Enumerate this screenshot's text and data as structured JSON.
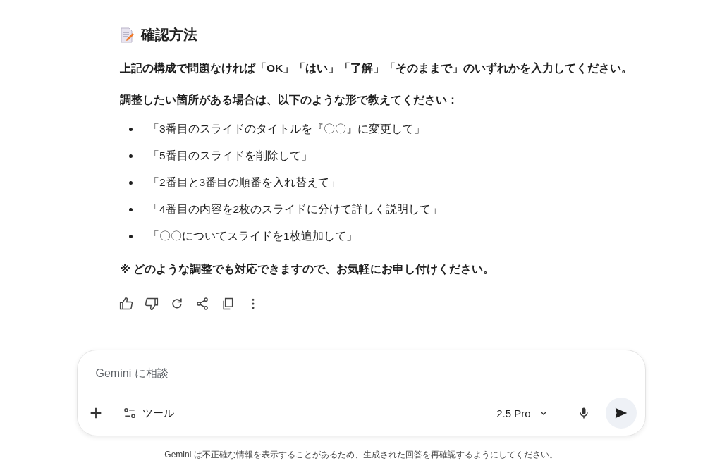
{
  "section": {
    "heading": "確認方法",
    "intro": "上記の構成で問題なければ「OK」「はい」「了解」「そのままで」のいずれかを入力してください。",
    "lead": "調整したい箇所がある場合は、以下のような形で教えてください：",
    "examples": [
      "「3番目のスライドのタイトルを『〇〇』に変更して」",
      "「5番目のスライドを削除して」",
      "「2番目と3番目の順番を入れ替えて」",
      "「4番目の内容を2枚のスライドに分けて詳しく説明して」",
      "「〇〇についてスライドを1枚追加して」"
    ],
    "note": "※ どのような調整でも対応できますので、お気軽にお申し付けください。"
  },
  "composer": {
    "placeholder": "Gemini に相談",
    "tools_label": "ツール",
    "model": "2.5 Pro"
  },
  "disclaimer": "Gemini は不正確な情報を表示することがあるため、生成された回答を再確認するようにしてください。"
}
